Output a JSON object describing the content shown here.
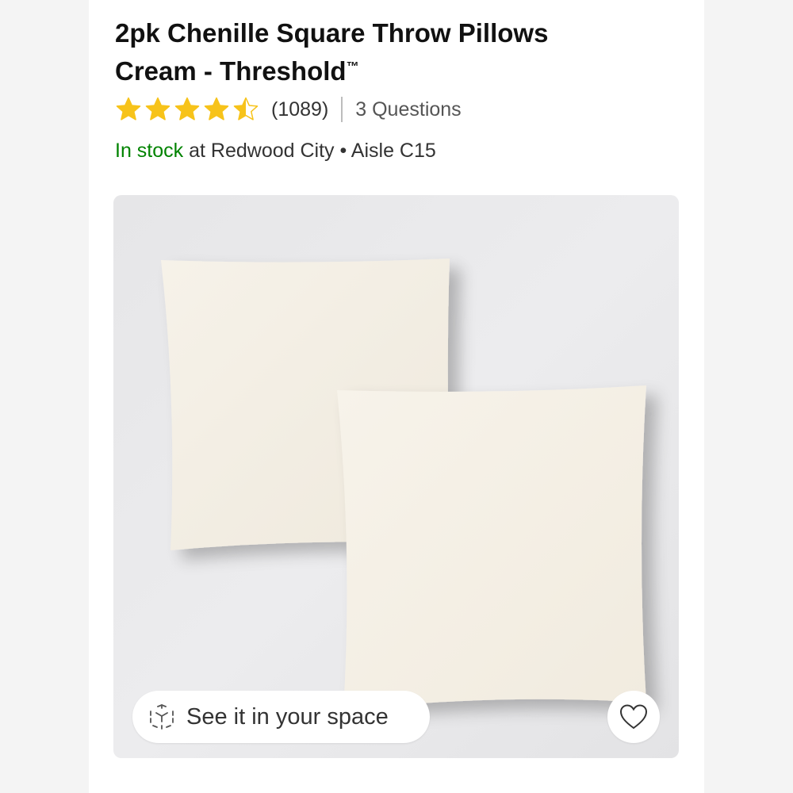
{
  "product": {
    "title_line1": "2pk Chenille Square Throw Pillows",
    "title_line2": "Cream - Threshold",
    "trademark": "™"
  },
  "rating": {
    "stars": 4.5,
    "max_stars": 5,
    "review_count": "(1089)",
    "questions": "3 Questions",
    "star_color": "#f7c31a"
  },
  "availability": {
    "status": "In stock",
    "location": "at Redwood City • Aisle C15",
    "status_color": "#008300"
  },
  "image_card": {
    "ar_button_label": "See it in your space",
    "ar_icon": "cube-3d-icon",
    "favorite_icon": "heart-icon"
  }
}
